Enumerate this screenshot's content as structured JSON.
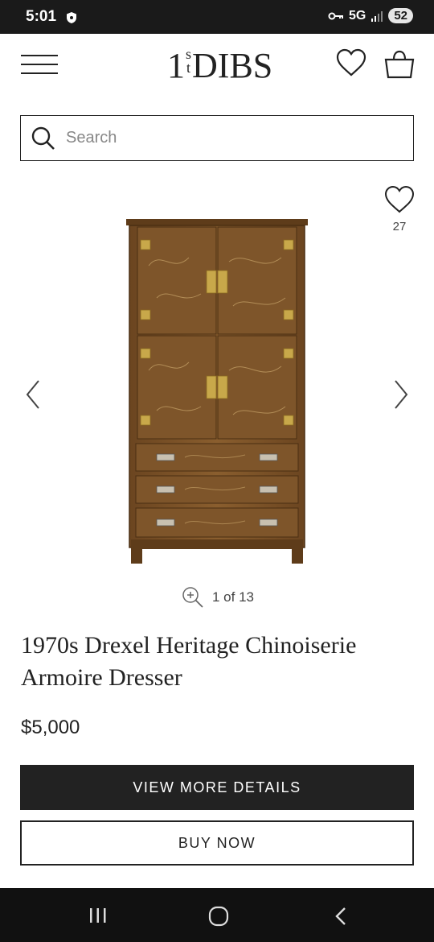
{
  "status_bar": {
    "time": "5:01",
    "network": "5G",
    "battery": "52",
    "icons": [
      "shield-icon",
      "key-icon",
      "signal-icon"
    ]
  },
  "header": {
    "logo": {
      "prefix": "1",
      "st_top": "s",
      "st_bottom": "t",
      "suffix": "DIBS"
    },
    "icons": [
      "menu-icon",
      "heart-icon",
      "bag-icon"
    ]
  },
  "search": {
    "placeholder": "Search",
    "value": ""
  },
  "product": {
    "favorite_count": "27",
    "image_counter": "1 of 13",
    "title": "1970s Drexel Heritage Chinoiserie Armoire Dresser",
    "price": "$5,000"
  },
  "actions": {
    "view_more": "VIEW MORE DETAILS",
    "buy_now": "BUY NOW"
  },
  "colors": {
    "text": "#222222",
    "dark": "#222222",
    "wood": "#7a5428"
  }
}
